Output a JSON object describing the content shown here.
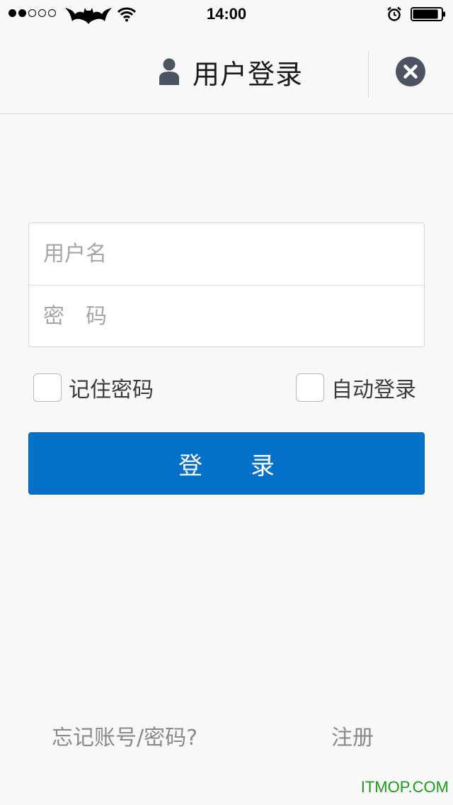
{
  "status_bar": {
    "signal_dots_filled": 2,
    "signal_dots_total": 5,
    "time": "14:00",
    "battery_level": 0.9
  },
  "header": {
    "title": "用户登录",
    "user_icon": "user-icon",
    "close_icon": "close-icon"
  },
  "form": {
    "username_placeholder": "用户名",
    "password_placeholder": "密　码",
    "remember_label": "记住密码",
    "auto_login_label": "自动登录",
    "login_label": "登　　录"
  },
  "footer": {
    "forgot_link": "忘记账号/密码?",
    "register_link": "注册"
  },
  "watermark": "ITMOP.COM",
  "colors": {
    "accent": "#0671c8",
    "close_button": "#4c5463",
    "background": "#f8f8f8",
    "watermark": "#1a9d1a"
  }
}
